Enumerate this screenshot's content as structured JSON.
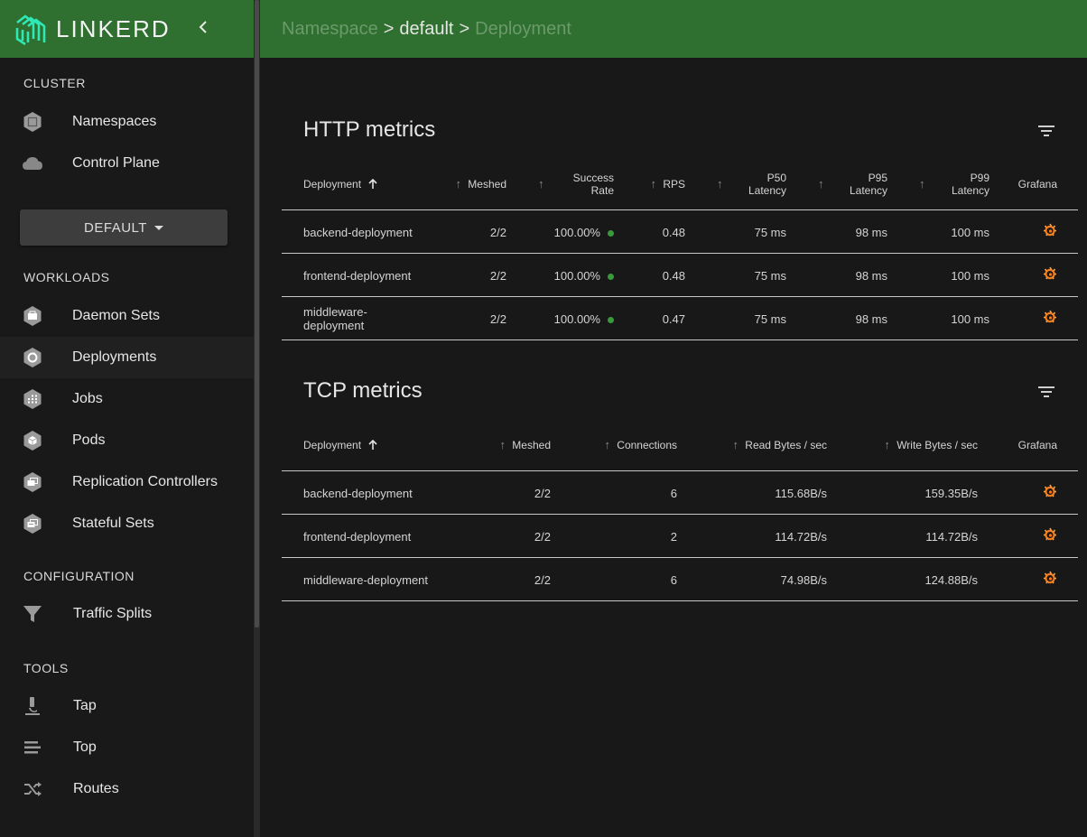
{
  "brand": {
    "name": "LINKERD"
  },
  "sidebar": {
    "cluster_title": "CLUSTER",
    "cluster_items": [
      {
        "label": "Namespaces",
        "icon": "namespace-icon"
      },
      {
        "label": "Control Plane",
        "icon": "cloud-icon"
      }
    ],
    "namespace_select": "DEFAULT",
    "workloads_title": "WORKLOADS",
    "workload_items": [
      {
        "label": "Daemon Sets",
        "icon": "daemonset-icon"
      },
      {
        "label": "Deployments",
        "icon": "deployment-icon",
        "active": true
      },
      {
        "label": "Jobs",
        "icon": "job-icon"
      },
      {
        "label": "Pods",
        "icon": "pod-icon"
      },
      {
        "label": "Replication Controllers",
        "icon": "replication-controller-icon"
      },
      {
        "label": "Stateful Sets",
        "icon": "statefulset-icon"
      }
    ],
    "configuration_title": "CONFIGURATION",
    "configuration_items": [
      {
        "label": "Traffic Splits",
        "icon": "filter-funnel-icon"
      }
    ],
    "tools_title": "TOOLS",
    "tools_items": [
      {
        "label": "Tap",
        "icon": "microscope-icon"
      },
      {
        "label": "Top",
        "icon": "top-list-icon"
      },
      {
        "label": "Routes",
        "icon": "shuffle-icon"
      }
    ]
  },
  "breadcrumb": {
    "namespace": "Namespace",
    "sep1": ">",
    "default": "default",
    "sep2": ">",
    "deployment": "Deployment"
  },
  "http": {
    "title": "HTTP metrics",
    "headers": {
      "deployment": "Deployment",
      "meshed": "Meshed",
      "success_1": "Success",
      "success_2": "Rate",
      "rps": "RPS",
      "p50_1": "P50",
      "p50_2": "Latency",
      "p95_1": "P95",
      "p95_2": "Latency",
      "p99_1": "P99",
      "p99_2": "Latency",
      "grafana": "Grafana"
    },
    "rows": [
      {
        "name": "backend-deployment",
        "meshed": "2/2",
        "success": "100.00%",
        "rps": "0.48",
        "p50": "75 ms",
        "p95": "98 ms",
        "p99": "100 ms"
      },
      {
        "name": "frontend-deployment",
        "meshed": "2/2",
        "success": "100.00%",
        "rps": "0.48",
        "p50": "75 ms",
        "p95": "98 ms",
        "p99": "100 ms"
      },
      {
        "name_1": "middleware-",
        "name_2": "deployment",
        "meshed": "2/2",
        "success": "100.00%",
        "rps": "0.47",
        "p50": "75 ms",
        "p95": "98 ms",
        "p99": "100 ms"
      }
    ],
    "status_color": "#3a9a3a"
  },
  "tcp": {
    "title": "TCP metrics",
    "headers": {
      "deployment": "Deployment",
      "meshed": "Meshed",
      "connections": "Connections",
      "read": "Read Bytes / sec",
      "write": "Write Bytes / sec",
      "grafana": "Grafana"
    },
    "rows": [
      {
        "name": "backend-deployment",
        "meshed": "2/2",
        "connections": "6",
        "read": "115.68B/s",
        "write": "159.35B/s"
      },
      {
        "name": "frontend-deployment",
        "meshed": "2/2",
        "connections": "2",
        "read": "114.72B/s",
        "write": "114.72B/s"
      },
      {
        "name": "middleware-deployment",
        "meshed": "2/2",
        "connections": "6",
        "read": "74.98B/s",
        "write": "124.88B/s"
      }
    ]
  },
  "colors": {
    "brand_green": "#2f6f2f",
    "grafana_orange": "#f47a20"
  }
}
